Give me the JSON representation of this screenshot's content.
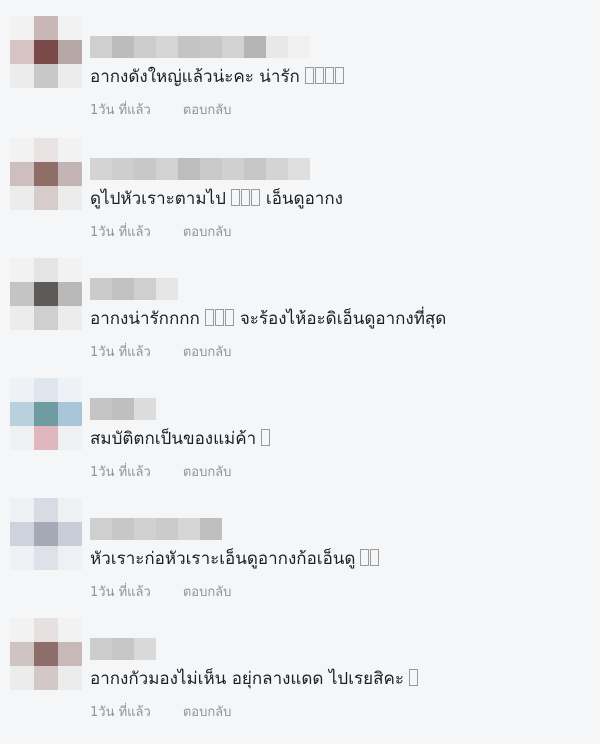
{
  "comments": [
    {
      "text": "อากงดังใหญ่แล้วน่ะคะ น่ารัก",
      "emoji_boxes": 4,
      "time": "1วัน ที่แล้ว",
      "reply": "ตอบกลับ",
      "avatar_colors": [
        "#f2f2f2",
        "#c9b7b7",
        "#f2f2f2",
        "#d6c4c4",
        "#7a4a48",
        "#b6a6a6",
        "#ececec",
        "#c8c8c8",
        "#ececec"
      ],
      "name_colors": [
        "#cfcfcf",
        "#bcbcbc",
        "#cccccc",
        "#d5d5d5",
        "#c4c4c4",
        "#c7c7c7",
        "#d2d2d2",
        "#b4b4b4",
        "#e8e8e8",
        "#f0f0f0"
      ]
    },
    {
      "text": "ดูไปหัวเราะตามไป",
      "emoji_boxes": 3,
      "text_after": "เอ็นดูอากง",
      "time": "1วัน ที่แล้ว",
      "reply": "ตอบกลับ",
      "avatar_colors": [
        "#f2f2f2",
        "#e8e2e2",
        "#f2f2f2",
        "#cdbfbf",
        "#8f6e68",
        "#c3b5b5",
        "#ececec",
        "#d8cbcb",
        "#ececec"
      ],
      "name_colors": [
        "#d4d4d4",
        "#cecece",
        "#c8c8c8",
        "#d2d2d2",
        "#bdbdbd",
        "#c9c9c9",
        "#d0d0d0",
        "#c6c6c6",
        "#d4d4d4",
        "#dedede"
      ]
    },
    {
      "text": "อากงน่ารักกกก",
      "emoji_boxes": 3,
      "text_after": "จะร้องไห้อะดิเอ็นดูอากงที่สุด",
      "time": "1วัน ที่แล้ว",
      "reply": "ตอบกลับ",
      "avatar_colors": [
        "#f2f2f2",
        "#e4e4e4",
        "#f2f2f2",
        "#c4c4c4",
        "#5e5a58",
        "#b9b9b9",
        "#ececec",
        "#cfcfcf",
        "#ececec"
      ],
      "name_colors": [
        "#cbcbcb",
        "#c2c2c2",
        "#cfcfcf",
        "#e6e6e6"
      ]
    },
    {
      "text": "สมบัติตกเป็นของแม่ค้า",
      "emoji_boxes": 1,
      "time": "1วัน ที่แล้ว",
      "reply": "ตอบกลับ",
      "avatar_colors": [
        "#eef2f6",
        "#dfe6ee",
        "#eef2f6",
        "#b9d0de",
        "#6f9ca0",
        "#a9c5d8",
        "#eef0f2",
        "#e0b7be",
        "#eef0f2"
      ],
      "name_colors": [
        "#c5c5c5",
        "#bfbfbf",
        "#dcdcdc"
      ]
    },
    {
      "text": "หัวเราะก่อหัวเราะเอ็นดูอากงก้อเอ็นดู",
      "emoji_boxes": 2,
      "time": "1วัน ที่แล้ว",
      "reply": "ตอบกลับ",
      "avatar_colors": [
        "#eef0f4",
        "#d9dbe4",
        "#eef0f4",
        "#ced2dc",
        "#a5a9b6",
        "#c9cdd8",
        "#eef0f4",
        "#dfe1e8",
        "#eef0f4"
      ],
      "name_colors": [
        "#cfcfcf",
        "#c7c7c7",
        "#d1d1d1",
        "#cbcbcb",
        "#d6d6d6",
        "#bfbfbf"
      ]
    },
    {
      "text": "อากงกัวมองไม่เห็น อยุ่กลางแดด ไปเรยสิคะ",
      "emoji_boxes": 1,
      "time": "1วัน ที่แล้ว",
      "reply": "ตอบกลับ",
      "avatar_colors": [
        "#f2f2f2",
        "#e6e0e0",
        "#f2f2f2",
        "#cfc3c3",
        "#8e6e6a",
        "#c8b8b8",
        "#ececec",
        "#d3c8c8",
        "#ececec"
      ],
      "name_colors": [
        "#cdcdcd",
        "#c6c6c6",
        "#d9d9d9"
      ]
    }
  ]
}
